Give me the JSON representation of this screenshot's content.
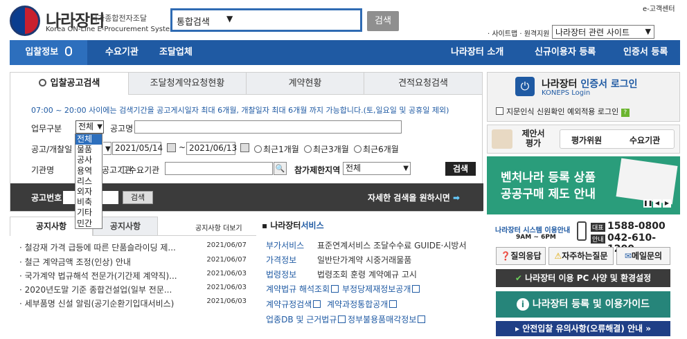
{
  "header": {
    "logo_title": "나라장터",
    "logo_subtitle": "국가종합전자조달",
    "logo_english": "Korea ON-Line E-Procurement System",
    "search_select_value": "통합검색",
    "search_button": "검색",
    "customer_center": "e-고객센터",
    "util_links": "· 사이트맵 · 원격지원",
    "related_site_select": "나라장터 관련 사이트"
  },
  "nav": {
    "items": [
      "입찰정보",
      "수요기관",
      "조달업체",
      "나라장터 소개",
      "신규이용자 등록",
      "인증서 등록"
    ]
  },
  "search_panel": {
    "tabs": [
      "입찰공고검색",
      "조달청계약요청현황",
      "계약현황",
      "견적요청검색"
    ],
    "info": "07:00 ~ 20:00 사이에는 검색기간을 공고게시일자 최대 6개월, 개찰일자 최대 6개월 까지 가능합니다.(토,일요일 및 공휴일 제외)",
    "work_type_label": "업무구분",
    "work_type_value": "전체",
    "notice_name_label": "공고명",
    "date_label": "공고/개찰일",
    "date_from": "2021/05/14",
    "date_to": "2021/06/13",
    "range_options": [
      "최근1개월",
      "최근3개월",
      "최근6개월"
    ],
    "agency_label": "기관명",
    "agency_options": [
      "공고기관",
      "수요기관"
    ],
    "region_label": "참가제한지역",
    "region_value": "전체",
    "search_button": "검색",
    "bid_no_label": "공고번호",
    "bid_no_button": "검색",
    "detail_link": "자세한 검색을 원하시면",
    "dropdown_options": [
      "전체",
      "물품",
      "공사",
      "용역",
      "리스",
      "외자",
      "비축",
      "기타",
      "민간"
    ]
  },
  "notice": {
    "tabs": [
      "공지사항",
      "공지사항"
    ],
    "more": "공지사항 더보기",
    "items": [
      {
        "title": "철강재 가격 급등에 따른 단품슬라이딩 제...",
        "date": "2021/06/07"
      },
      {
        "title": "철근 계약금액 조정(인상) 안내",
        "date": "2021/06/07"
      },
      {
        "title": "국가계약 법규해석 전문가(기간제 계약직)...",
        "date": "2021/06/03"
      },
      {
        "title": "2020년도말 기준 종합건설업(일부 전문...",
        "date": "2021/06/03"
      },
      {
        "title": "세부품명 신설 알림(공기순환기입대서비스)",
        "date": "2021/06/03"
      }
    ]
  },
  "service": {
    "title_prefix": "나라장터",
    "title_suffix": "서비스",
    "rows": [
      {
        "cat": "부가서비스",
        "val": "표준연계서비스  조달수수료  GUIDE·시방서"
      },
      {
        "cat": "가격정보",
        "val": "일반단가계약  시중거래물품"
      },
      {
        "cat": "법령정보",
        "val": "법령조회    훈령    계약예규    고시"
      },
      {
        "cat": "계약법규 해석조회",
        "val": "부정당제재정보공개"
      },
      {
        "cat": "계약규정검색",
        "val": "계약과정통합공개"
      },
      {
        "cat": "업종DB 및 근거법규",
        "val": "정부불용품매각정보"
      }
    ]
  },
  "right": {
    "login_title_prefix": "나라장터",
    "login_title_suffix": "인증서 로그인",
    "login_sub": "KONEPS Login",
    "fingerprint_text": "지문인식 신원확인 예외적용 로그인",
    "proposal": "제안서 평가",
    "proposal_links": [
      "평가위원",
      "수요기관"
    ],
    "banner_line1": "벤처나라 등록 상품",
    "banner_line2": "공공구매 제도 안내",
    "contact_label": "나라장터 시스템 이용안내",
    "contact_hours": "9AM ~ 6PM",
    "phone_main_tag": "대표",
    "phone_main": "1588-0800",
    "phone_alt_tag": "안내",
    "phone_alt": "042-610-1200",
    "quick_buttons": [
      "질의응답",
      "자주하는질문",
      "메일문의"
    ],
    "pc_spec": "나라장터 이용 PC 사양 및 환경설정",
    "register_guide": "나라장터 등록 및 이용가이드",
    "safe_bid": "안전입찰 유의사항(오류해결) 안내"
  }
}
